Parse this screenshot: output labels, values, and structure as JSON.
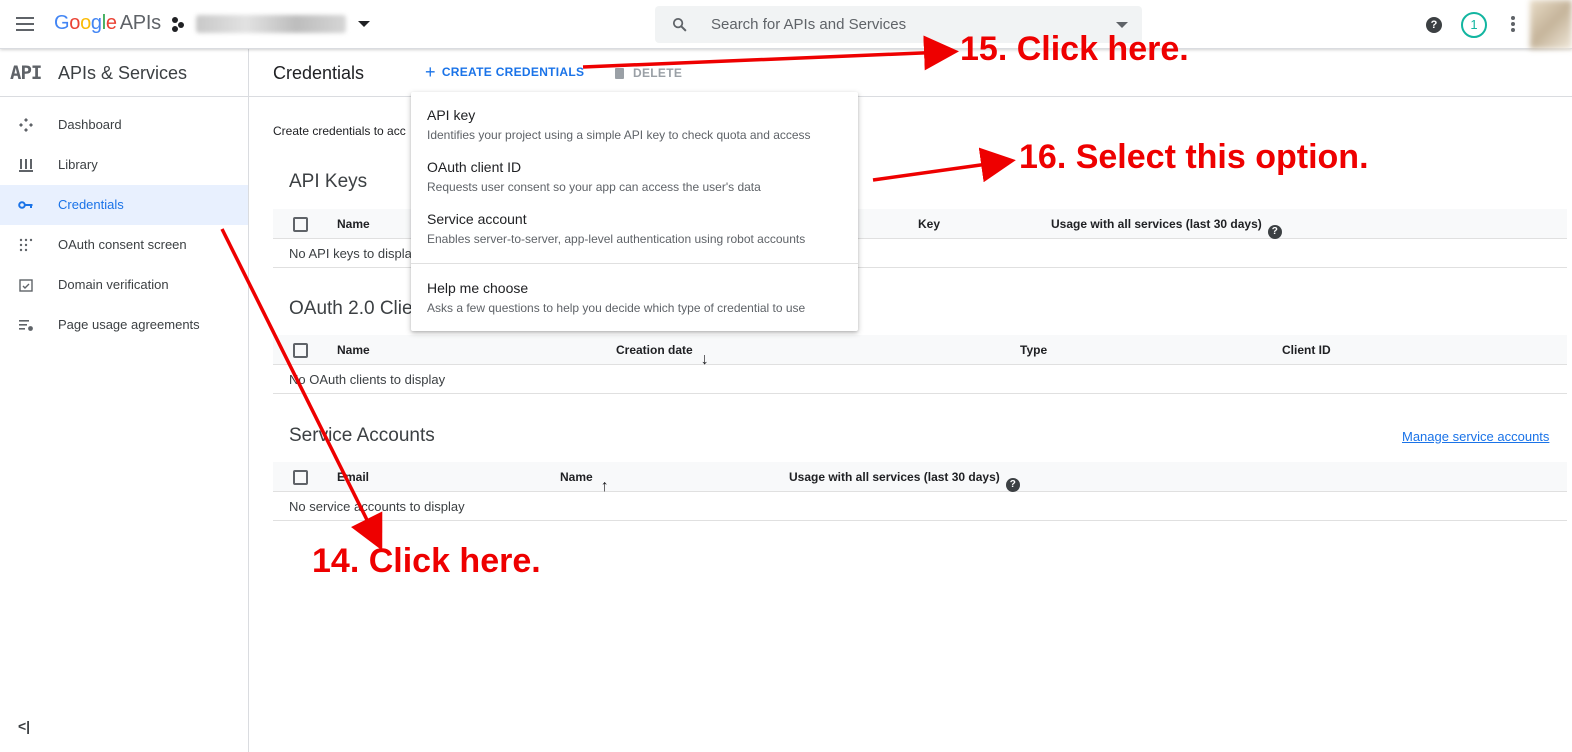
{
  "topbar": {
    "logo_google": [
      "G",
      "o",
      "o",
      "g",
      "l",
      "e"
    ],
    "logo_apis": "APIs",
    "search_placeholder": "Search for APIs and Services",
    "notifications_count": "1",
    "help_label": "?"
  },
  "sidebar": {
    "badge": "API",
    "title": "APIs & Services",
    "items": [
      {
        "label": "Dashboard",
        "icon": "dashboard-icon"
      },
      {
        "label": "Library",
        "icon": "library-icon"
      },
      {
        "label": "Credentials",
        "icon": "key-icon",
        "active": true
      },
      {
        "label": "OAuth consent screen",
        "icon": "oauth-consent-icon"
      },
      {
        "label": "Domain verification",
        "icon": "domain-verification-icon"
      },
      {
        "label": "Page usage agreements",
        "icon": "page-usage-icon"
      }
    ],
    "collapse_label": "<|"
  },
  "main": {
    "title": "Credentials",
    "create_label": "CREATE CREDENTIALS",
    "delete_label": "DELETE",
    "intro": "Create credentials to acc",
    "api_keys": {
      "title": "API Keys",
      "columns": [
        "Name",
        "Key",
        "Usage with all services (last 30 days)"
      ],
      "empty": "No API keys to displa"
    },
    "oauth": {
      "title": "OAuth 2.0 Clie",
      "columns": [
        "Name",
        "Creation date",
        "Type",
        "Client ID"
      ],
      "empty": "No OAuth clients to display"
    },
    "service_accounts": {
      "title": "Service Accounts",
      "manage_link": "Manage service accounts",
      "columns": [
        "Email",
        "Name",
        "Usage with all services (last 30 days)"
      ],
      "empty": "No service accounts to display"
    }
  },
  "menu": {
    "items": [
      {
        "title": "API key",
        "desc": "Identifies your project using a simple API key to check quota and access"
      },
      {
        "title": "OAuth client ID",
        "desc": "Requests user consent so your app can access the user's data"
      },
      {
        "title": "Service account",
        "desc": "Enables server-to-server, app-level authentication using robot accounts"
      },
      {
        "title": "Help me choose",
        "desc": "Asks a few questions to help you decide which type of credential to use"
      }
    ]
  },
  "annotations": {
    "step15": "15. Click here.",
    "step16": "16. Select this option.",
    "step14": "14. Click here."
  },
  "colors": {
    "accent": "#1a73e8",
    "annotation": "#ee0000"
  }
}
